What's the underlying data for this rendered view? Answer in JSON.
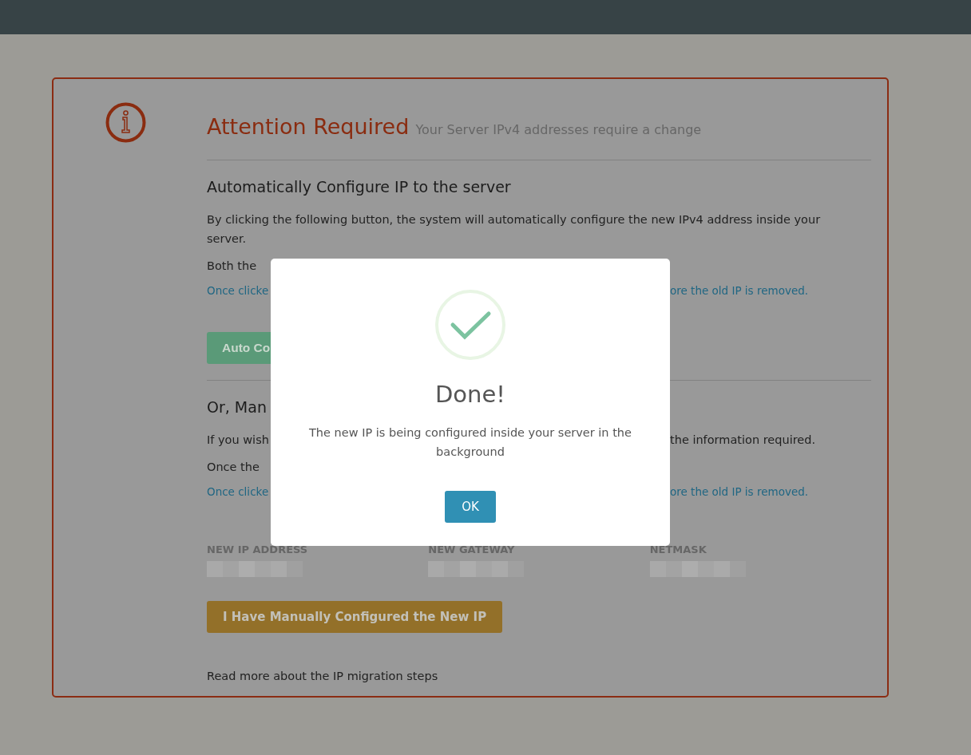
{
  "card": {
    "title": "Attention Required",
    "subtitle": "Your Server IPv4 addresses require a change",
    "auto_section": {
      "heading": "Automatically Configure IP to the server",
      "paragraph": "By clicking the following button, the system will automatically configure the new IPv4 address inside your server.",
      "paragraph_2": "Both the",
      "note_left": "Once clicke",
      "note_right": "ore the old IP is removed.",
      "button": "Auto Co"
    },
    "manual_section": {
      "heading": "Or, Man",
      "paragraph_left": "If you wish",
      "paragraph_right": "the information required.",
      "paragraph_2": "Once the",
      "note_left": "Once clicke",
      "note_right": "ore the old IP is removed.",
      "fields": [
        {
          "label": "NEW IP ADDRESS"
        },
        {
          "label": "NEW GATEWAY"
        },
        {
          "label": "NETMASK"
        }
      ],
      "button": "I Have Manually Configured the New IP"
    },
    "footer_link": "Read more about the IP migration steps"
  },
  "dialog": {
    "title": "Done!",
    "message": "The new IP is being configured inside your server in the background",
    "button": "OK"
  }
}
